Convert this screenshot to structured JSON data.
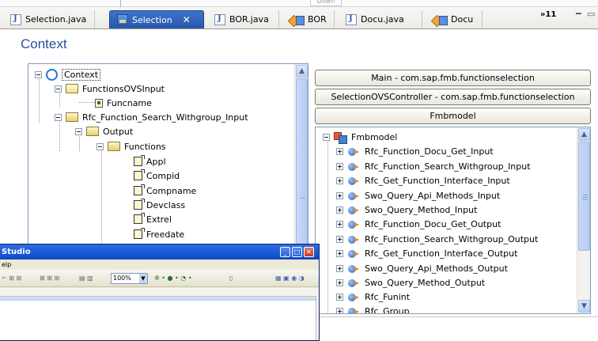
{
  "top": {
    "down_label": "Down"
  },
  "tabs": [
    {
      "label": "Selection.java",
      "icon": "java-file-icon",
      "active": false
    },
    {
      "label": "Selection",
      "icon": "view-icon",
      "active": true
    },
    {
      "label": "BOR.java",
      "icon": "java-file-icon",
      "active": false
    },
    {
      "label": "BOR",
      "icon": "component-icon",
      "active": false
    },
    {
      "label": "Docu.java",
      "icon": "java-file-icon",
      "active": false
    },
    {
      "label": "Docu",
      "icon": "component-icon",
      "active": false
    }
  ],
  "tabs_overflow": "»11",
  "context_header": "Context",
  "context_tree": [
    {
      "label": "Context",
      "icon": "context-node-icon",
      "level": 0,
      "expanded": true
    },
    {
      "label": "FunctionsOVSInput",
      "icon": "folder-icon",
      "level": 1,
      "expanded": true
    },
    {
      "label": "Funcname",
      "icon": "attribute-icon",
      "level": 2
    },
    {
      "label": "Rfc_Function_Search_Withgroup_Input",
      "icon": "folder-icon",
      "level": 1,
      "expanded": true
    },
    {
      "label": "Output",
      "icon": "folder-icon",
      "level": 2,
      "expanded": true
    },
    {
      "label": "Functions",
      "icon": "folder-icon",
      "level": 3,
      "expanded": true
    },
    {
      "label": "Appl",
      "icon": "attribute-icon",
      "level": 4
    },
    {
      "label": "Compid",
      "icon": "attribute-icon",
      "level": 4
    },
    {
      "label": "Compname",
      "icon": "attribute-icon",
      "level": 4
    },
    {
      "label": "Devclass",
      "icon": "attribute-icon",
      "level": 4
    },
    {
      "label": "Extrel",
      "icon": "attribute-icon",
      "level": 4
    },
    {
      "label": "Freedate",
      "icon": "attribute-icon",
      "level": 4
    }
  ],
  "controllers": [
    "Main - com.sap.fmb.functionselection",
    "SelectionOVSController - com.sap.fmb.functionselection",
    "Fmbmodel"
  ],
  "model_tree": {
    "root": "Fmbmodel",
    "items": [
      "Rfc_Function_Docu_Get_Input",
      "Rfc_Function_Search_Withgroup_Input",
      "Rfc_Get_Function_Interface_Input",
      "Swo_Query_Api_Methods_Input",
      "Swo_Query_Method_Input",
      "Rfc_Function_Docu_Get_Output",
      "Rfc_Function_Search_Withgroup_Output",
      "Rfc_Get_Function_Interface_Output",
      "Swo_Query_Api_Methods_Output",
      "Swo_Query_Method_Output",
      "Rfc_Funint",
      "Rfc_Group"
    ]
  },
  "studio_window": {
    "title": "Studio",
    "menu": "elp",
    "zoom": "100%"
  },
  "colors": {
    "header_blue": "#2a4f9e",
    "active_tab": "#2f63bd",
    "titlebar": "#0b4ac5"
  }
}
